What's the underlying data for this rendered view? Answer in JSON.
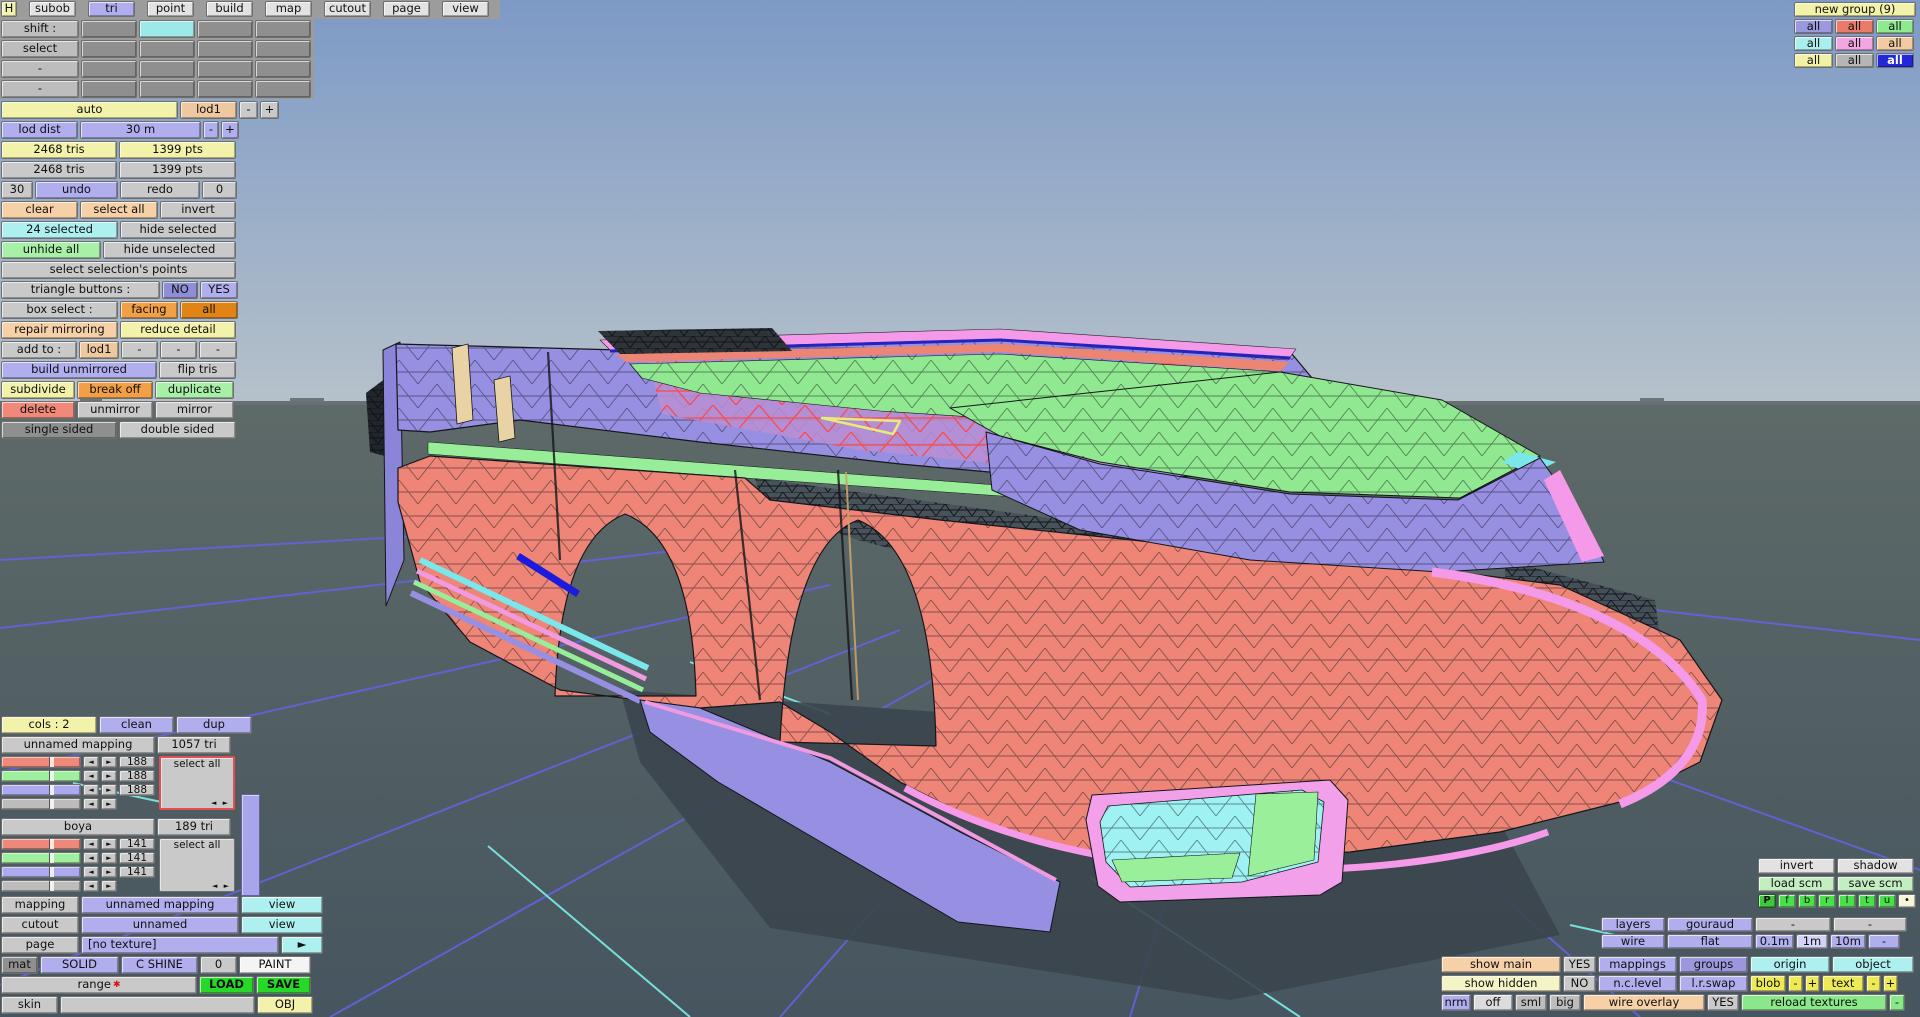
{
  "menubar": {
    "items": [
      "H",
      "subob",
      "tri",
      "point",
      "build",
      "map",
      "cutout",
      "page",
      "view"
    ],
    "active_item": "tri"
  },
  "shift_grid": {
    "row_labels": [
      "shift :",
      "select",
      "-",
      "-"
    ]
  },
  "left_panel": {
    "auto_label": "auto",
    "lod_label": "lod1",
    "minus": "-",
    "plus": "+",
    "lod_dist_label": "lod dist",
    "lod_dist_value": "30 m",
    "tris_count": "2468 tris",
    "pts_count": "1399 pts",
    "tris_count2": "2468 tris",
    "pts_count2": "1399 pts",
    "undo_steps": "30",
    "undo_label": "undo",
    "redo_label": "redo",
    "redo_steps": "0",
    "clear_label": "clear",
    "select_all_label": "select all",
    "invert_label": "invert",
    "selected_count": "24 selected",
    "hide_selected": "hide selected",
    "unhide_all": "unhide all",
    "hide_unselected": "hide unselected",
    "select_selections_points": "select selection's points",
    "triangle_buttons_label": "triangle buttons :",
    "no_label": "NO",
    "yes_label": "YES",
    "box_select_label": "box select :",
    "facing_label": "facing",
    "all_label": "all",
    "repair_mirroring": "repair mirroring",
    "reduce_detail": "reduce detail",
    "add_to_label": "add to :",
    "add_to_target": "lod1",
    "dash": "-",
    "build_unmirrored": "build unmirrored",
    "flip_tris": "flip tris",
    "subdivide": "subdivide",
    "break_off": "break off",
    "duplicate": "duplicate",
    "delete_label": "delete",
    "unmirror": "unmirror",
    "mirror": "mirror",
    "single_sided": "single sided",
    "double_sided": "double sided"
  },
  "groups_panel": {
    "new_group_label": "new group (9)",
    "buttons": [
      {
        "label": "all",
        "color": "#9b99dd"
      },
      {
        "label": "all",
        "color": "#ea7b6b"
      },
      {
        "label": "all",
        "color": "#8fe98f"
      },
      {
        "label": "all",
        "color": "#abeeee"
      },
      {
        "label": "all",
        "color": "#f2a6e2"
      },
      {
        "label": "all",
        "color": "#f2cba2"
      },
      {
        "label": "all",
        "color": "#f2f2a6"
      },
      {
        "label": "all",
        "color": "#b5b5b5"
      },
      {
        "label": "all",
        "color": "#2228d8",
        "active": true
      }
    ]
  },
  "materials_panel": {
    "cols_label": "cols : 2",
    "clean_label": "clean",
    "dup_label": "dup",
    "channel_colors": [
      "#ee8878",
      "#9ef09e",
      "#abaaee",
      "#bcbcbc"
    ],
    "materials": [
      {
        "name": "unnamed mapping",
        "tri_count": "1057 tri",
        "select_all": "select all",
        "r": "188",
        "g": "188",
        "b": "188",
        "highlighted": true
      },
      {
        "name": "boya",
        "tri_count": "189 tri",
        "select_all": "select all",
        "r": "141",
        "g": "141",
        "b": "141",
        "highlighted": false
      }
    ]
  },
  "bottom_rows": {
    "mapping_label": "mapping",
    "mapping_value": "unnamed mapping",
    "view_label": "view",
    "cutout_label": "cutout",
    "cutout_value": "unnamed",
    "page_label": "page",
    "page_value": "[no texture]",
    "page_arrow": "►",
    "mat_label": "mat",
    "solid_label": "SOLID",
    "cshine_label": "C SHINE",
    "shine_value": "0",
    "paint_label": "PAINT",
    "range_label": "range",
    "range_star": "✱",
    "load_label": "LOAD",
    "save_label": "SAVE",
    "skin_label": "skin",
    "obj_label": "OBJ"
  },
  "right_panel": {
    "invert_label": "invert",
    "shadow_label": "shadow",
    "load_scm": "load scm",
    "save_scm": "save scm",
    "proj_buttons": [
      "P",
      "f",
      "b",
      "r",
      "l",
      "t",
      "u",
      "•"
    ],
    "layers_label": "layers",
    "gouraud_label": "gouraud",
    "dash": "-",
    "wire_label": "wire",
    "flat_label": "flat",
    "dist_01": "0.1m",
    "dist_1": "1m",
    "dist_10": "10m",
    "show_main": "show main",
    "show_main_state": "YES",
    "mappings_label": "mappings",
    "groups_label": "groups",
    "origin_label": "origin",
    "object_label": "object",
    "show_hidden": "show hidden",
    "show_hidden_state": "NO",
    "nc_level": "n.c.level",
    "lr_swap": "l.r.swap",
    "blob_label": "blob",
    "minus": "-",
    "plus": "+",
    "text_label": "text",
    "nrm_label": "nrm",
    "off_label": "off",
    "sml_label": "sml",
    "big_label": "big",
    "wire_overlay": "wire overlay",
    "wire_overlay_state": "YES",
    "reload_textures": "reload textures"
  },
  "viewport": {
    "sky_top_color": "#7d9ac6",
    "sky_horizon_color": "#b6c1ca",
    "ground_top_color": "#5e6a68",
    "ground_bottom_color": "#46555f",
    "grid_line_color": "#6462de",
    "grid_accent_color": "#79e8e2",
    "model_colors": {
      "body": "#ee8576",
      "roof_band": "#978fe2",
      "hood": "#90e890",
      "trim": "#f49ae8",
      "glass": "#9ef2f2",
      "selection_wire": "#ff4646",
      "highlight_triangle": "#e9e97c",
      "wireframe": "#15151a",
      "accent_blue": "#2424bc"
    }
  }
}
